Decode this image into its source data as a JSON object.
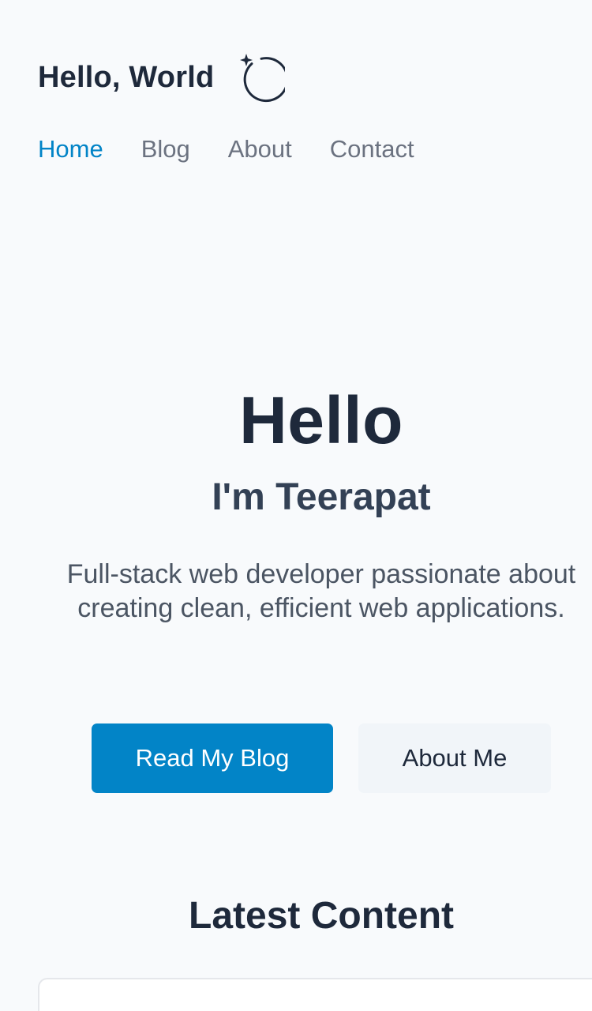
{
  "header": {
    "brand_title": "Hello, World",
    "theme_toggle_icon": "theme-toggle-icon",
    "nav": {
      "home": "Home",
      "blog": "Blog",
      "about": "About",
      "contact": "Contact"
    },
    "active_nav": "Home"
  },
  "hero": {
    "title": "Hello",
    "subtitle": "I'm Teerapat",
    "description": "Full-stack web developer passionate about creating clean, efficient web applications.",
    "primary_button": "Read My Blog",
    "secondary_button": "About Me"
  },
  "latest": {
    "title": "Latest Content"
  },
  "colors": {
    "accent": "#0284c7",
    "background": "#f8fafc",
    "text": "#1e293b"
  }
}
